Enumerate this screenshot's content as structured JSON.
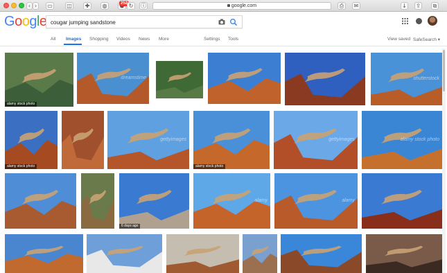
{
  "browser": {
    "url": "google.com",
    "badge": "252"
  },
  "google": {
    "logo_letters": [
      {
        "ch": "G",
        "color": "#4285F4"
      },
      {
        "ch": "o",
        "color": "#EA4335"
      },
      {
        "ch": "o",
        "color": "#FBBC05"
      },
      {
        "ch": "g",
        "color": "#4285F4"
      },
      {
        "ch": "l",
        "color": "#34A853"
      },
      {
        "ch": "e",
        "color": "#EA4335"
      }
    ],
    "search_query": "cougar jumping sandstone"
  },
  "nav": {
    "all": "All",
    "images": "Images",
    "shopping": "Shopping",
    "videos": "Videos",
    "news": "News",
    "more": "More",
    "settings": "Settings",
    "tools": "Tools",
    "view_saved": "View saved",
    "safesearch": "SafeSearch ▾"
  },
  "images": [
    {
      "label": "alamy stock photo",
      "wm": "",
      "sky": "#5a7a4a",
      "rock": "#3c5f3a"
    },
    {
      "label": "",
      "wm": "dreamstime",
      "sky": "#4a8fd0",
      "rock": "#b45a2a"
    },
    {
      "label": "",
      "wm": "",
      "sky": "#3f6a35",
      "rock": "#587a45"
    },
    {
      "label": "",
      "wm": "",
      "sky": "#3c7fd2",
      "rock": "#c0622c"
    },
    {
      "label": "",
      "wm": "",
      "sky": "#2f5fbf",
      "rock": "#8a3a20"
    },
    {
      "label": "",
      "wm": "shutterstock",
      "sky": "#4a92d8",
      "rock": "#b85c28"
    },
    {
      "label": "alamy stock photo",
      "wm": "",
      "sky": "#3a6fc2",
      "rock": "#a64a22"
    },
    {
      "label": "",
      "wm": "",
      "sky": "#a0502c",
      "rock": "#c06a3a"
    },
    {
      "label": "",
      "wm": "gettyimages",
      "sky": "#5fa0e0",
      "rock": "#b4562a"
    },
    {
      "label": "alamy stock photo",
      "wm": "",
      "sky": "#4a90d8",
      "rock": "#c4682c"
    },
    {
      "label": "",
      "wm": "gettyimages",
      "sky": "#6aa8e8",
      "rock": "#b24e28"
    },
    {
      "label": "",
      "wm": "alamy stock photo",
      "sky": "#3a86d4",
      "rock": "#c6702e"
    },
    {
      "label": "",
      "wm": "",
      "sky": "#4f8ed6",
      "rock": "#a85a30"
    },
    {
      "label": "",
      "wm": "",
      "sky": "#6a7a4a",
      "rock": "#8a6a40"
    },
    {
      "label": "6 days ago",
      "wm": "",
      "sky": "#3a7ad0",
      "rock": "#b0a090"
    },
    {
      "label": "",
      "wm": "alamy",
      "sky": "#5fa8e8",
      "rock": "#c4642a"
    },
    {
      "label": "",
      "wm": "alamy",
      "sky": "#4c94e0",
      "rock": "#b85a2a"
    },
    {
      "label": "",
      "wm": "",
      "sky": "#3a7ad2",
      "rock": "#8a2e1c"
    },
    {
      "label": "",
      "wm": "",
      "sky": "#4a86d0",
      "rock": "#c06a30"
    },
    {
      "label": "",
      "wm": "",
      "sky": "#6f9fd8",
      "rock": "#e8e8e8"
    },
    {
      "label": "",
      "wm": "",
      "sky": "#c4bdb0",
      "rock": "#a05a32"
    },
    {
      "label": "",
      "wm": "",
      "sky": "#7aa0d0",
      "rock": "#9a7050"
    },
    {
      "label": "",
      "wm": "",
      "sky": "#3a86d8",
      "rock": "#8a4a2a"
    },
    {
      "label": "",
      "wm": "",
      "sky": "#7a5a48",
      "rock": "#3a2a22"
    }
  ]
}
